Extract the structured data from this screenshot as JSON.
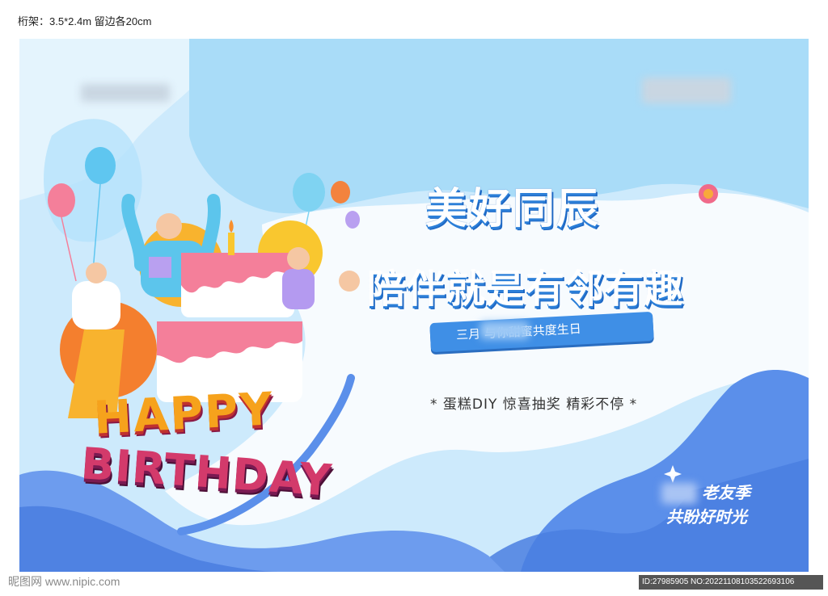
{
  "spec_text": "桁架：3.5*2.4m  留边各20cm",
  "poster": {
    "title_line1": "美好同辰",
    "title_line2": "陪伴就是有邻有趣",
    "ribbon_text": "三月        与你甜蜜共度生日",
    "slogan": "* 蛋糕DIY  惊喜抽奖  精彩不停 *",
    "corner_line1": "老友季",
    "corner_line2": "共盼好时光",
    "happy_text": "HAPPY",
    "birthday_text": "BIRTHDAY"
  },
  "watermark": {
    "left": "昵图网  www.nipic.com",
    "right": "ID:27985905 NO:20221108103522693106"
  },
  "colors": {
    "poster_bg": "#e6f4fd",
    "light_blue": "#b8e4fb",
    "mid_blue": "#8fd0f6",
    "deep_blue": "#4f86e8",
    "title_shadow": "#2c7fd8",
    "cake_pink": "#f47f9a",
    "happy_orange": "#f6a21c",
    "birthday_magenta": "#d33a6b"
  }
}
